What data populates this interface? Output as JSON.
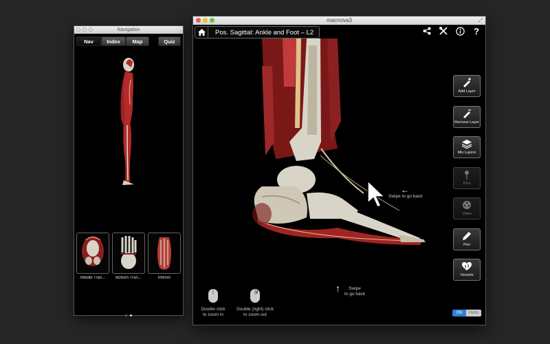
{
  "nav_window": {
    "title": "Navigation",
    "tabs": [
      {
        "label": "Nav",
        "active": true
      },
      {
        "label": "Index",
        "active": false
      },
      {
        "label": "Map",
        "active": false
      },
      {
        "label": "Quiz",
        "active": false
      }
    ],
    "thumbnails": [
      {
        "label": "Middle Tran..."
      },
      {
        "label": "Bottom Tran..."
      },
      {
        "label": "Inferior"
      }
    ],
    "page_dots": {
      "count": 2,
      "current": 2
    }
  },
  "main_window": {
    "title": "macnova3",
    "breadcrumb": "Pos. Sagittal: Ankle and Foot – L2",
    "top_icons": [
      "share-icon",
      "tools-icon",
      "info-icon",
      "help-icon"
    ],
    "tools": [
      {
        "label": "Add Layer",
        "icon": "add-layer-icon",
        "enabled": true
      },
      {
        "label": "Remove Layer",
        "icon": "remove-layer-icon",
        "enabled": true
      },
      {
        "label": "Mix Layers",
        "icon": "layers-icon",
        "enabled": true
      },
      {
        "label": "Pins",
        "icon": "pin-icon",
        "enabled": false
      },
      {
        "label": "Video",
        "icon": "film-reel-icon",
        "enabled": false
      },
      {
        "label": "Pen",
        "icon": "pen-icon",
        "enabled": true
      },
      {
        "label": "Vessels",
        "icon": "heart-icon",
        "enabled": true
      }
    ],
    "hints": {
      "swipe_left": "Swipe to go back",
      "swipe_up_line1": "Swipe",
      "swipe_up_line2": "to go back",
      "double_click_line1": "Double click",
      "double_click_line2": "to zoom in",
      "double_right_line1": "Double (right) click",
      "double_right_line2": "to zoom out"
    },
    "hints_toggle": {
      "on_label": "ON",
      "off_label": "Hints",
      "state": "on"
    }
  },
  "colors": {
    "desktop": "#262626",
    "toggle_on": "#2f7fd6",
    "muscle": "#b22a2a",
    "bone": "#d8d4c8"
  }
}
